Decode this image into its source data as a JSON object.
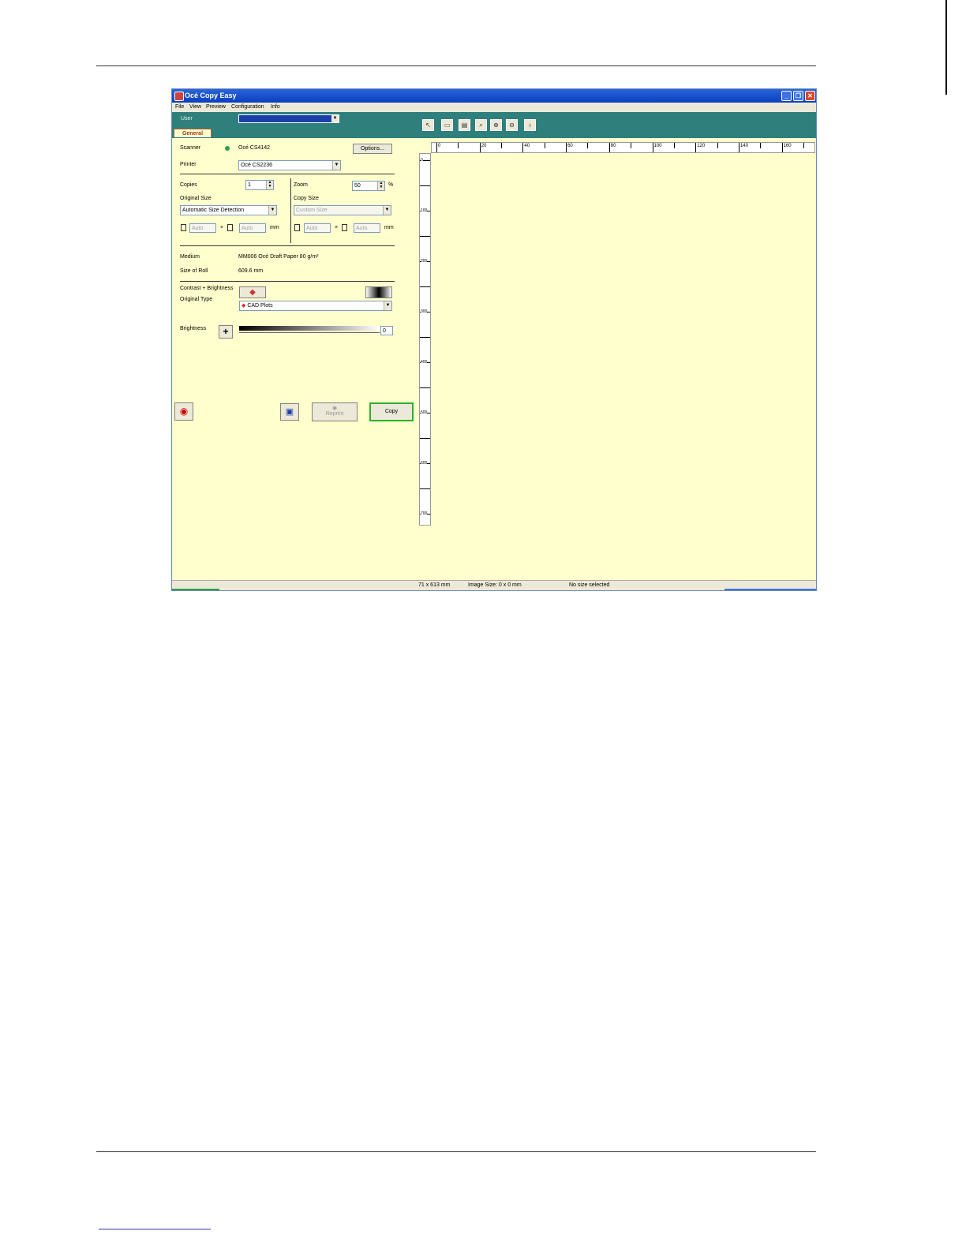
{
  "window": {
    "title": "Océ Copy Easy"
  },
  "menu": [
    "File",
    "View",
    "Preview",
    "Configuration",
    "Info"
  ],
  "header": {
    "user_label": "User",
    "tab_general": "General"
  },
  "scanner": {
    "label": "Scanner",
    "value": "Océ CS4142",
    "options_button": "Options..."
  },
  "printer": {
    "label": "Printer",
    "value": "Océ CS2236"
  },
  "copies": {
    "label": "Copies",
    "value": "1"
  },
  "zoom": {
    "label": "Zoom",
    "value": "50",
    "unit": "%"
  },
  "original_size": {
    "label": "Original Size",
    "value": "Automatic Size Detection",
    "width": "Auto",
    "height": "Auto",
    "unit": "mm"
  },
  "copy_size": {
    "label": "Copy Size",
    "value": "Custom Size",
    "width": "Auto",
    "height": "Auto",
    "unit": "mm"
  },
  "times_sign": "×",
  "medium": {
    "label": "Medium",
    "value": "MM006 Océ Draft Paper 80 g/m²"
  },
  "roll": {
    "label": "Size of Roll",
    "value": "609.6 mm"
  },
  "contrast": {
    "label": "Contrast + Brightness"
  },
  "original_type": {
    "label": "Original Type",
    "value": "CAD Plots"
  },
  "brightness": {
    "label": "Brightness",
    "value": "0",
    "level": 0
  },
  "actions": {
    "reprint": "Reprint",
    "copy": "Copy"
  },
  "ruler": {
    "top_labels": [
      "0",
      "20",
      "40",
      "60",
      "80",
      "100",
      "120",
      "140",
      "160"
    ],
    "left_labels": [
      "0",
      "100",
      "200",
      "300",
      "400",
      "500",
      "600",
      "700"
    ]
  },
  "status": {
    "dimensions": "71 x 613 mm",
    "image_size": "Image Size: 0 x 0 mm",
    "selection": "No size selected"
  },
  "colors": {
    "panel_bg": "#ffffce",
    "teal_bar": "#2f7f7d",
    "title_bar": "#0a3fbf",
    "copy_button_border": "#2ab12a"
  }
}
